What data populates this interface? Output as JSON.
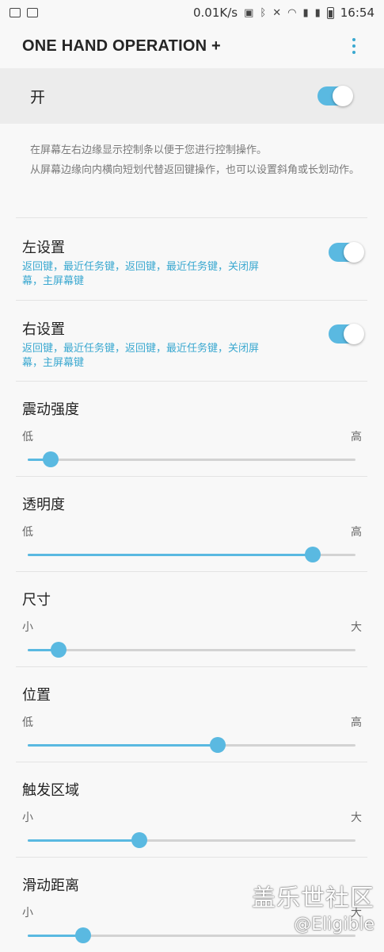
{
  "status_bar": {
    "speed": "0.01K/s",
    "time": "16:54"
  },
  "app_bar": {
    "title": "ONE HAND OPERATION +"
  },
  "master": {
    "label": "开",
    "on": true
  },
  "description": [
    "在屏幕左右边缘显示控制条以便于您进行控制操作。",
    "从屏幕边缘向内横向短划代替返回键操作，也可以设置斜角或长划动作。"
  ],
  "left_setting": {
    "title": "左设置",
    "subtitle": "返回键，最近任务键，返回键，最近任务键，关闭屏幕，主屏幕键",
    "on": true
  },
  "right_setting": {
    "title": "右设置",
    "subtitle": "返回键，最近任务键，返回键，最近任务键，关闭屏幕，主屏幕键",
    "on": true
  },
  "sliders": [
    {
      "title": "震动强度",
      "min_label": "低",
      "max_label": "高",
      "value": 0.07
    },
    {
      "title": "透明度",
      "min_label": "低",
      "max_label": "高",
      "value": 0.87
    },
    {
      "title": "尺寸",
      "min_label": "小",
      "max_label": "大",
      "value": 0.095
    },
    {
      "title": "位置",
      "min_label": "低",
      "max_label": "高",
      "value": 0.58
    },
    {
      "title": "触发区域",
      "min_label": "小",
      "max_label": "大",
      "value": 0.34
    },
    {
      "title": "滑动距离",
      "min_label": "小",
      "max_label": "大",
      "value": 0.17
    }
  ],
  "watermark": {
    "line1": "盖乐世社区",
    "line2": "@Eligible"
  },
  "colors": {
    "accent": "#5ab9e1",
    "accent_text": "#3aa8d0",
    "background": "#f8f8f8"
  }
}
